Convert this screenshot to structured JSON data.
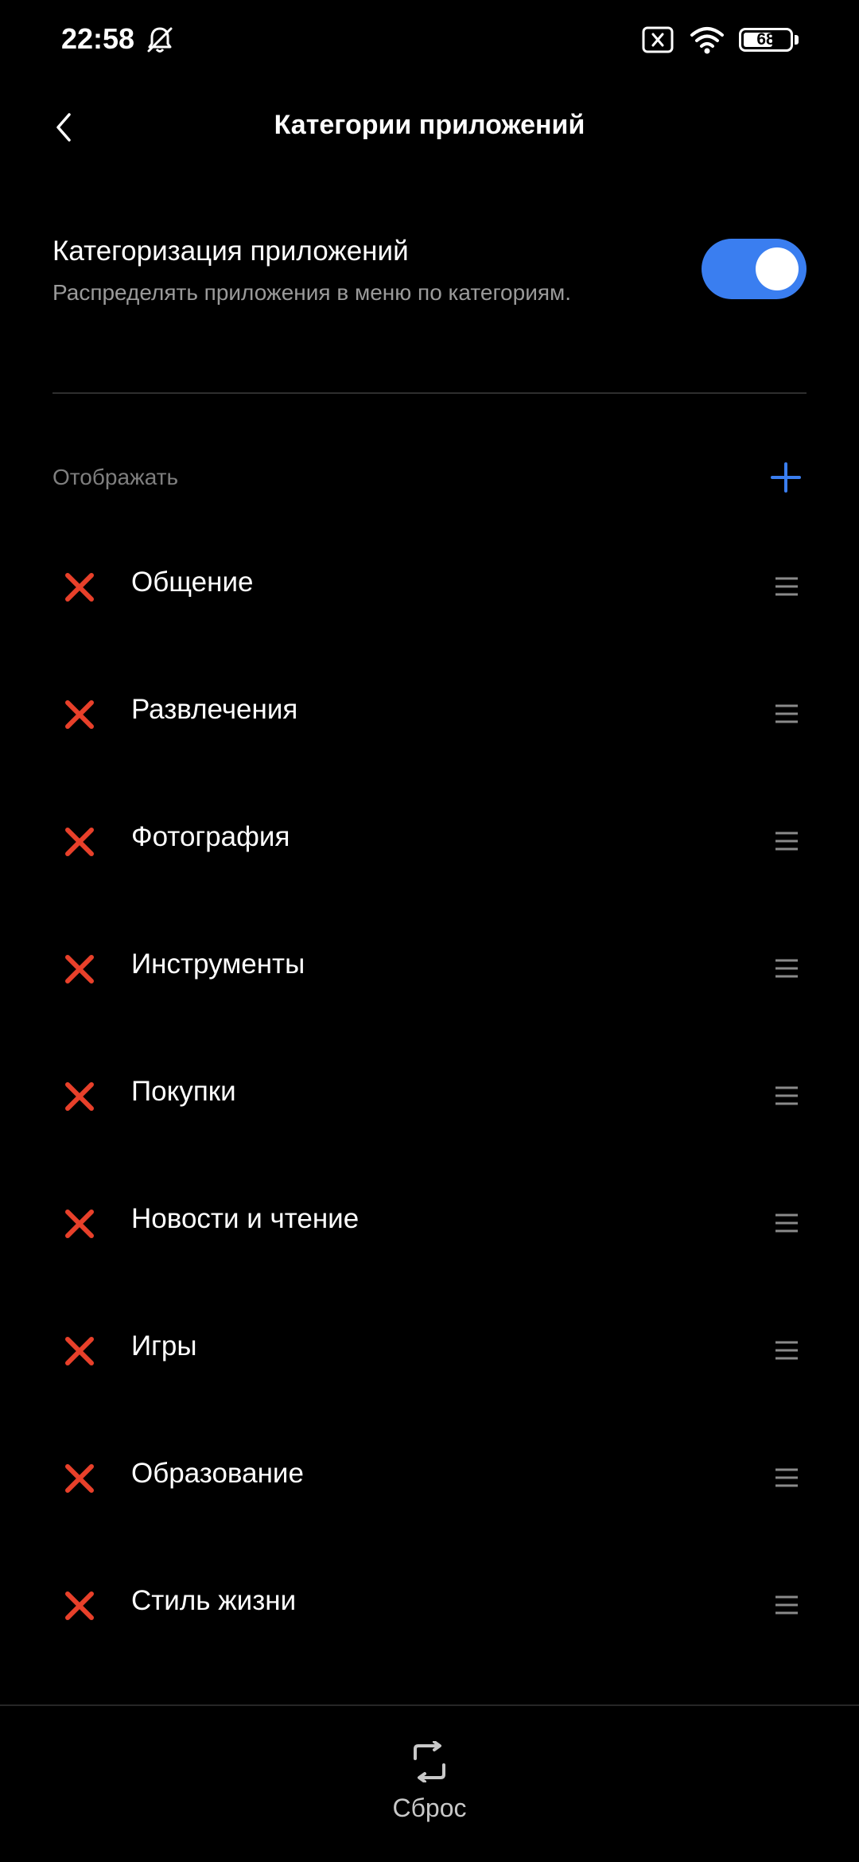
{
  "status_bar": {
    "time": "22:58",
    "battery_level": "68",
    "icons": [
      "bell-off-icon",
      "sim-off-icon",
      "wifi-icon",
      "battery-icon"
    ]
  },
  "header": {
    "title": "Категории приложений",
    "back_icon": "chevron-left-icon"
  },
  "categorization": {
    "title": "Категоризация приложений",
    "description": "Распределять приложения в меню по категориям.",
    "enabled": true
  },
  "display_section": {
    "label": "Отображать",
    "add_icon": "plus-icon"
  },
  "categories": [
    {
      "label": "Общение"
    },
    {
      "label": "Развлечения"
    },
    {
      "label": "Фотография"
    },
    {
      "label": "Инструменты"
    },
    {
      "label": "Покупки"
    },
    {
      "label": "Новости и чтение"
    },
    {
      "label": "Игры"
    },
    {
      "label": "Образование"
    },
    {
      "label": "Стиль жизни"
    }
  ],
  "footer": {
    "reset_label": "Сброс",
    "reset_icon": "reset-icon"
  },
  "colors": {
    "background": "#000000",
    "accent": "#3a7ef0",
    "remove": "#e8402a",
    "secondary_text": "#9a9a9a",
    "handle": "#8a8a8a"
  }
}
